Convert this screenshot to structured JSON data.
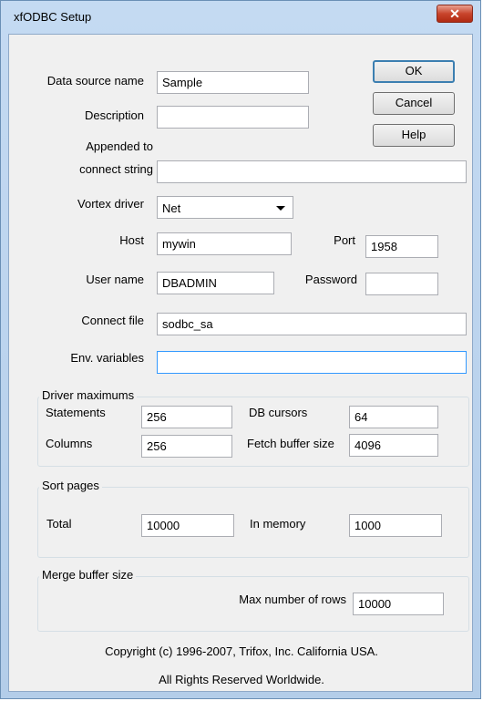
{
  "window": {
    "title": "xfODBC Setup",
    "close_symbol": "✕"
  },
  "buttons": {
    "ok": "OK",
    "cancel": "Cancel",
    "help": "Help"
  },
  "form": {
    "data_source_name": {
      "label": "Data source name",
      "value": "Sample"
    },
    "description": {
      "label": "Description",
      "value": ""
    },
    "appended": {
      "label_line1": "Appended to",
      "label_line2": "connect string",
      "value": ""
    },
    "vortex_driver": {
      "label": "Vortex driver",
      "value": "Net"
    },
    "host": {
      "label": "Host",
      "value": "mywin"
    },
    "port": {
      "label": "Port",
      "value": "1958"
    },
    "user_name": {
      "label": "User name",
      "value": "DBADMIN"
    },
    "password": {
      "label": "Password",
      "value": ""
    },
    "connect_file": {
      "label": "Connect file",
      "value": "sodbc_sa"
    },
    "env_variables": {
      "label": "Env. variables",
      "value": ""
    }
  },
  "driver_maximums": {
    "title": "Driver maximums",
    "statements": {
      "label": "Statements",
      "value": "256"
    },
    "db_cursors": {
      "label": "DB cursors",
      "value": "64"
    },
    "columns": {
      "label": "Columns",
      "value": "256"
    },
    "fetch_buffer_size": {
      "label": "Fetch buffer size",
      "value": "4096"
    }
  },
  "sort_pages": {
    "title": "Sort pages",
    "total": {
      "label": "Total",
      "value": "10000"
    },
    "in_memory": {
      "label": "In memory",
      "value": "1000"
    }
  },
  "merge_buffer": {
    "title": "Merge buffer size",
    "max_rows": {
      "label": "Max number of rows",
      "value": "10000"
    }
  },
  "footer": {
    "copyright": "Copyright (c) 1996-2007, Trifox, Inc. California USA.",
    "rights": "All Rights Reserved Worldwide."
  }
}
